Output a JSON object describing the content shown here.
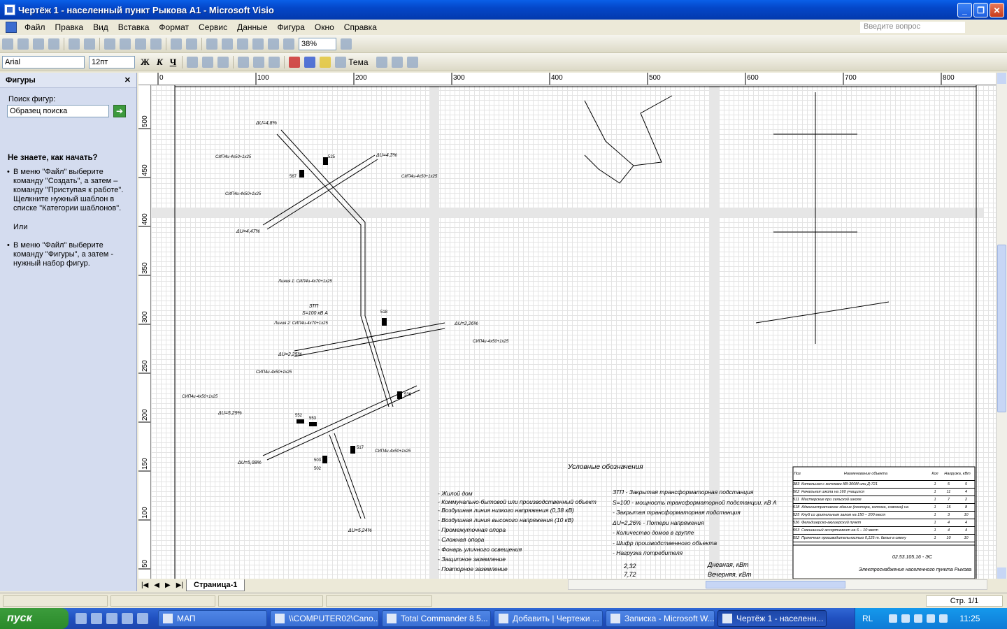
{
  "window": {
    "title": "Чертёж 1 - населенный пункт Рыкова А1 - Microsoft Visio"
  },
  "menu": [
    "Файл",
    "Правка",
    "Вид",
    "Вставка",
    "Формат",
    "Сервис",
    "Данные",
    "Фигура",
    "Окно",
    "Справка"
  ],
  "help_placeholder": "Введите вопрос",
  "toolbar": {
    "zoom": "38%",
    "font": "Arial",
    "size": "12пт",
    "bold": "Ж",
    "italic": "К",
    "underline": "Ч",
    "theme": "Тема"
  },
  "taskpane": {
    "title": "Фигуры",
    "search_label": "Поиск фигур:",
    "search_value": "Образец поиска",
    "question": "Не знаете, как начать?",
    "p1": "В меню \"Файл\" выберите команду \"Создать\", а затем – команду \"Приступая к работе\". Щелкните нужный шаблон в списке \"Категории шаблонов\".",
    "or": "Или",
    "p2": "В меню \"Файл\" выберите команду \"Фигуры\", а затем - нужный набор фигур."
  },
  "ruler_h": [
    "0",
    "100",
    "200",
    "300",
    "400",
    "500",
    "600",
    "700",
    "800"
  ],
  "ruler_v": [
    "500",
    "450",
    "400",
    "350",
    "300",
    "250",
    "200",
    "150",
    "100",
    "50"
  ],
  "drawing": {
    "du": [
      "ΔU=4,8%",
      "ΔU=4,3%",
      "ΔU=4,47%",
      "ΔU=2,26%",
      "ΔU=2,25%",
      "ΔU=5,29%",
      "ΔU=5,08%",
      "ΔU=5,24%"
    ],
    "cables": [
      "СИП4u-4x50+1x25",
      "СИП4u-4x50+1x25",
      "СИП4u-4x50+1x25",
      "СИП4u-4x50+1x25",
      "СИП4u-4x50+1x25",
      "СИП4u-4x50+1x25",
      "СИП4u-4x50+1x25"
    ],
    "lines": [
      "Линия 1: СИП4u-4x70+1x25",
      "Линия 2: СИП4u-4x70+1x25"
    ],
    "ztp": "ЗТП",
    "power": "S=100 кВ А",
    "codes": [
      "525",
      "567",
      "518",
      "536",
      "553",
      "552",
      "503",
      "517",
      "502"
    ],
    "legend_title": "Условные обозначения",
    "legend_left": [
      "- Жилой дом",
      "- Коммунально-бытовой или производственный объект",
      "- Воздушная линия низкого напряжения (0,38 кВ)",
      "- Воздушная линия высокого напряжения (10 кВ)",
      "- Промежуточная опора",
      "- Сложная опора",
      "- Фонарь уличного освещения",
      "- Защитное заземление",
      "- Повторное заземление"
    ],
    "legend_right": [
      "ЗТП - Закрытая трансформаторная подстанция",
      "S=100 - мощность трансформаторной подстанции, кВ А",
      "- Закрытая трансформаторная подстанция",
      "ΔU=2,26% - Потери напряжения",
      "- Количество домов в группе",
      "- Шифр производственного объекта",
      "- Нагрузка потребителя"
    ],
    "load_top": "2,32",
    "load_bottom": "7,72",
    "day": "Дневная, кВт",
    "evening": "Вечерняя, кВт",
    "table_header": [
      "Поз",
      "Наименование объекта",
      "Кол",
      "Нагрузка, кВт"
    ],
    "table_rows": [
      [
        "383",
        "Котельная с котлами КВ-300М или Д-721",
        "1",
        "5",
        "5"
      ],
      [
        "502",
        "Начальная школа на 160 учащихся",
        "1",
        "11",
        "4"
      ],
      [
        "511",
        "Мастерские при сельской школе",
        "1",
        "7",
        "2"
      ],
      [
        "518",
        "Административное здание (контора, колхоза, совхоза) на",
        "1",
        "15",
        "8"
      ],
      [
        "525",
        "Клуб со зрительным залом на 150 – 200 мест",
        "1",
        "3",
        "10"
      ],
      [
        "536",
        "Фельдшерско-акушерский пункт",
        "1",
        "4",
        "4"
      ],
      [
        "553",
        "Смешанный ассортимент на 6 – 10 мест",
        "1",
        "4",
        "4"
      ],
      [
        "552",
        "Прачечная производительностью 0,125 т. белья в смену",
        "1",
        "10",
        "10"
      ]
    ],
    "doc_code": "02.53.105.16 - ЭС",
    "doc_name": "Электроснабжение населенного пункта Рыкова"
  },
  "page_tab": "Страница-1",
  "status": {
    "page": "Стр. 1/1"
  },
  "taskbar": {
    "start": "пуск",
    "buttons": [
      "МАП",
      "\\\\COMPUTER02\\Cano...",
      "Total Commander 8.5...",
      "Добавить | Чертежи ...",
      "Записка - Microsoft W...",
      "Чертёж 1 - населенн..."
    ],
    "lang": "RL",
    "clock": "11:25"
  }
}
